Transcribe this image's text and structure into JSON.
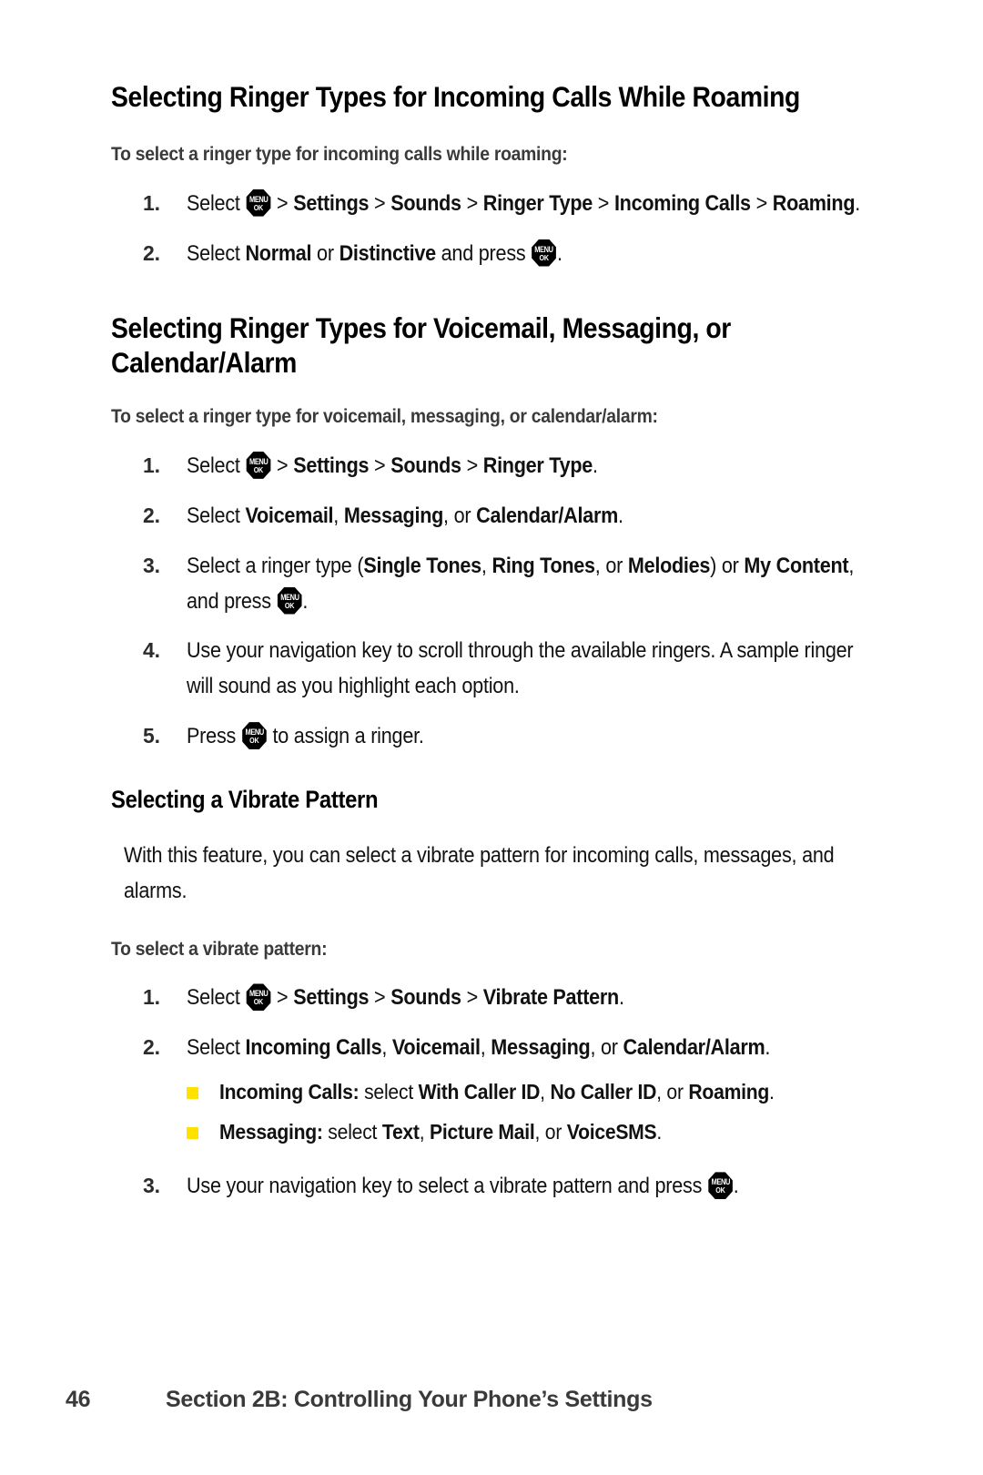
{
  "document": {
    "page_number": "46",
    "footer_title": "Section 2B: Controlling Your Phone’s Settings",
    "bullet_color": "#FFE200",
    "intro_color": "#3A3A3A",
    "menu_key_icon": {
      "name": "menu-ok-key-icon",
      "line1": "MENU",
      "line2": "OK"
    }
  },
  "section1": {
    "heading": "Selecting Ringer Types for Incoming Calls While Roaming",
    "intro": "To select a ringer type for incoming calls while roaming:",
    "steps": [
      {
        "num": "1.",
        "p1": "Select ",
        "p2": " > ",
        "b1": "Settings",
        "p3": " > ",
        "b2": "Sounds",
        "p4": " > ",
        "b3": "Ringer Type",
        "p5": " > ",
        "b4": "Incoming Calls",
        "p6": " > ",
        "b5": "Roaming",
        "p7": "."
      },
      {
        "num": "2.",
        "p1": "Select ",
        "b1": "Normal",
        "p2": " or ",
        "b2": "Distinctive",
        "p3": " and press ",
        "p4": "."
      }
    ]
  },
  "section2": {
    "heading": "Selecting Ringer Types for Voicemail, Messaging, or Calendar/Alarm",
    "intro": "To select a ringer type for voicemail, messaging, or calendar/alarm:",
    "steps": [
      {
        "num": "1.",
        "p1": "Select ",
        "p2": " > ",
        "b1": "Settings",
        "p3": " > ",
        "b2": "Sounds",
        "p4": " > ",
        "b3": "Ringer Type",
        "p5": "."
      },
      {
        "num": "2.",
        "p1": "Select ",
        "b1": "Voicemail",
        "p2": ", ",
        "b2": "Messaging",
        "p3": ", or ",
        "b3": "Calendar/Alarm",
        "p4": "."
      },
      {
        "num": "3.",
        "p1": "Select a ringer type (",
        "b1": "Single Tones",
        "p2": ", ",
        "b2": "Ring Tones",
        "p3": ", or ",
        "b3": "Melodies",
        "p4": ") or ",
        "b4": "My Content",
        "p5": ", and press ",
        "p6": "."
      },
      {
        "num": "4.",
        "p1": "Use your navigation key to scroll through the available ringers. A sample ringer will sound as you highlight each option."
      },
      {
        "num": "5.",
        "p1": "Press ",
        "p2": " to assign a ringer."
      }
    ]
  },
  "section3": {
    "heading": "Selecting a Vibrate Pattern",
    "paragraph": "With this feature, you can select a vibrate pattern for incoming calls, messages, and alarms.",
    "intro": "To select a vibrate pattern:",
    "steps": [
      {
        "num": "1.",
        "p1": "Select ",
        "p2": " > ",
        "b1": "Settings",
        "p3": " > ",
        "b2": "Sounds",
        "p4": " > ",
        "b3": "Vibrate Pattern",
        "p5": "."
      },
      {
        "num": "2.",
        "p1": "Select ",
        "b1": "Incoming Calls",
        "p2": ", ",
        "b2": "Voicemail",
        "p3": ", ",
        "b3": "Messaging",
        "p4": ", or ",
        "b4": "Calendar/Alarm",
        "p5": "."
      },
      {
        "num": "3.",
        "p1": "Use your navigation key to select a vibrate pattern and press ",
        "p2": "."
      }
    ],
    "sub_bullets": [
      {
        "b1": "Incoming Calls:",
        "p1": " select ",
        "b2": "With Caller ID",
        "p2": ", ",
        "b3": "No Caller ID",
        "p3": ", or ",
        "b4": "Roaming",
        "p4": "."
      },
      {
        "b1": "Messaging:",
        "p1": " select ",
        "b2": "Text",
        "p2": ", ",
        "b3": "Picture Mail",
        "p3": ", or ",
        "b4": "VoiceSMS",
        "p4": "."
      }
    ]
  }
}
